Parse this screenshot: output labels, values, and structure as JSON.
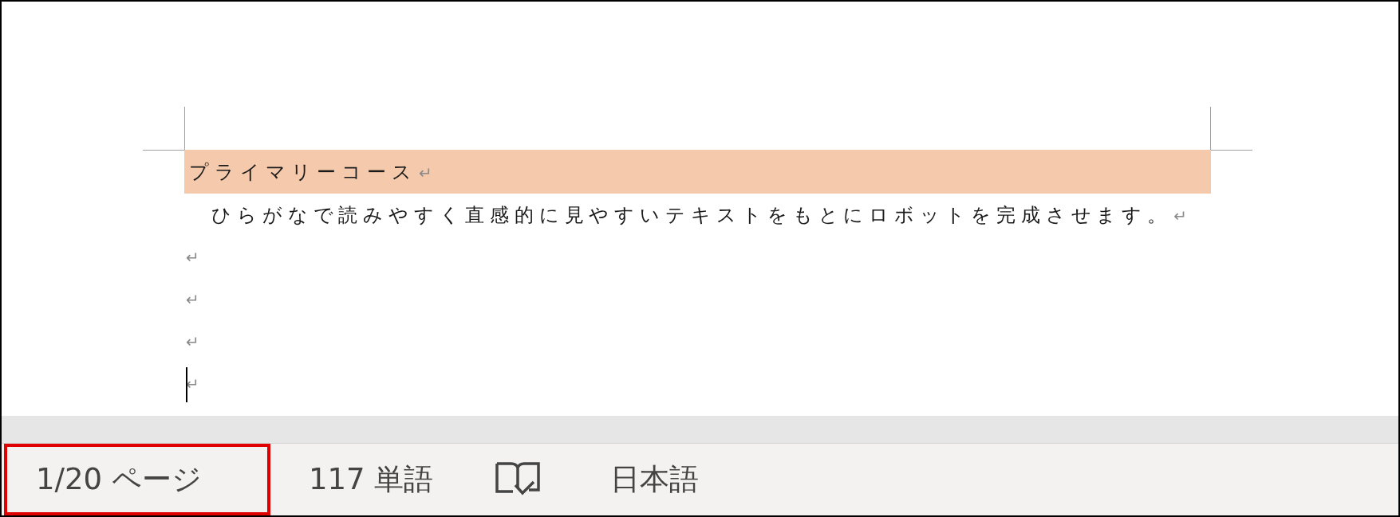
{
  "document": {
    "paragraphs": [
      {
        "kind": "heading",
        "text": "プライマリーコース",
        "mark": "↵",
        "caret": false
      },
      {
        "kind": "body",
        "text": "ひらがなで読みやすく直感的に見やすいテキストをもとにロボットを完成させます。",
        "mark": "↵",
        "caret": false
      },
      {
        "kind": "empty",
        "mark": "↵",
        "caret": false
      },
      {
        "kind": "empty",
        "mark": "↵",
        "caret": false
      },
      {
        "kind": "empty",
        "mark": "↵",
        "caret": false
      },
      {
        "kind": "empty",
        "mark": "↵",
        "caret": true
      }
    ]
  },
  "status_bar": {
    "items": [
      {
        "kind": "text",
        "label": "1/20 ページ",
        "highlighted": true
      },
      {
        "kind": "text",
        "label": "117 単語",
        "highlighted": false
      },
      {
        "kind": "icon",
        "highlighted": false
      },
      {
        "kind": "text",
        "label": "日本語",
        "highlighted": false
      }
    ]
  }
}
